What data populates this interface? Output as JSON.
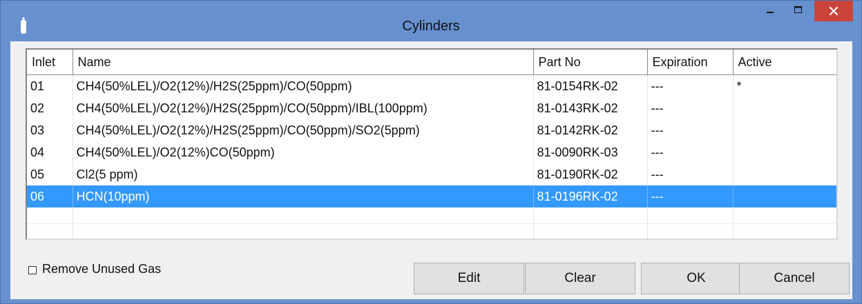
{
  "window": {
    "title": "Cylinders",
    "icon": "cylinder-icon",
    "controls": {
      "minimize": "minimize-icon",
      "maximize": "maximize-icon",
      "close": "close-icon"
    },
    "colors": {
      "titlebar": "#6790cf",
      "close": "#c9443b",
      "selection": "#3399ff"
    }
  },
  "table": {
    "columns": [
      "Inlet",
      "Name",
      "Part No",
      "Expiration",
      "Active"
    ],
    "rows": [
      {
        "inlet": "01",
        "name": "CH4(50%LEL)/O2(12%)/H2S(25ppm)/CO(50ppm)",
        "part_no": "81-0154RK-02",
        "expiration": "---",
        "active": "*",
        "selected": false
      },
      {
        "inlet": "02",
        "name": "CH4(50%LEL)/O2(12%)/H2S(25ppm)/CO(50ppm)/IBL(100ppm)",
        "part_no": "81-0143RK-02",
        "expiration": "---",
        "active": "",
        "selected": false
      },
      {
        "inlet": "03",
        "name": "CH4(50%LEL)/O2(12%)/H2S(25ppm)/CO(50ppm)/SO2(5ppm)",
        "part_no": "81-0142RK-02",
        "expiration": "---",
        "active": "",
        "selected": false
      },
      {
        "inlet": "04",
        "name": "CH4(50%LEL)/O2(12%)CO(50ppm)",
        "part_no": "81-0090RK-03",
        "expiration": "---",
        "active": "",
        "selected": false
      },
      {
        "inlet": "05",
        "name": "Cl2(5 ppm)",
        "part_no": "81-0190RK-02",
        "expiration": "---",
        "active": "",
        "selected": false
      },
      {
        "inlet": "06",
        "name": "HCN(10ppm)",
        "part_no": "81-0196RK-02",
        "expiration": "---",
        "active": "",
        "selected": true
      }
    ]
  },
  "options": {
    "remove_unused_gas_label": "Remove Unused Gas",
    "remove_unused_gas_checked": false
  },
  "buttons": {
    "edit": "Edit",
    "clear": "Clear",
    "ok": "OK",
    "cancel": "Cancel"
  }
}
